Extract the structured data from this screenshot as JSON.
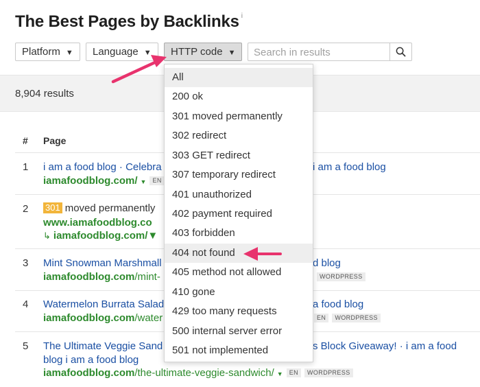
{
  "page": {
    "title": "The Best Pages by Backlinks",
    "title_info": "i"
  },
  "filters": {
    "platform": "Platform",
    "language": "Language",
    "http_code": "HTTP code",
    "search_placeholder": "Search in results"
  },
  "results": {
    "count": "8,904 results"
  },
  "table": {
    "headers": {
      "num": "#",
      "page": "Page"
    },
    "rows": [
      {
        "num": "1",
        "title_left": "i am a food blog · Celebra",
        "title_right": "i am a food blog",
        "url": "iamafoodblog.com/",
        "tag1": "EN"
      },
      {
        "num": "2",
        "status_code": "301",
        "status_text": "moved permanently",
        "url": "www.iamafoodblog.co",
        "redirect_url": "iamafoodblog.com/"
      },
      {
        "num": "3",
        "title_left": "Mint Snowman Marshmall",
        "title_right": "d blog",
        "url_domain": "iamafoodblog.com",
        "url_path": "/mint-",
        "tag2": "WORDPRESS"
      },
      {
        "num": "4",
        "title_left": "Watermelon Burrata Salad",
        "title_right": "a food blog",
        "url_domain": "iamafoodblog.com",
        "url_path": "/water",
        "tag1": "EN",
        "tag2": "WORDPRESS"
      },
      {
        "num": "5",
        "title_left": "The Ultimate Veggie Sand",
        "title_right": "s Block Giveaway! · i am a food",
        "title_line2": "blog i am a food blog",
        "url_domain": "iamafoodblog.com",
        "url_path": "/the-ultimate-veggie-sandwich/",
        "tag1": "EN",
        "tag2": "WORDPRESS"
      }
    ]
  },
  "dropdown": {
    "options": [
      "All",
      "200 ok",
      "301 moved permanently",
      "302 redirect",
      "303 GET redirect",
      "307 temporary redirect",
      "401 unauthorized",
      "402 payment required",
      "403 forbidden",
      "404 not found",
      "405 method not allowed",
      "410 gone",
      "429 too many requests",
      "500 internal server error",
      "501 not implemented"
    ]
  },
  "colors": {
    "link": "#1a4fa3",
    "url": "#2d8a2d",
    "badge": "#f2b53b",
    "annotation_arrow": "#e8336d"
  },
  "icons": [
    "search-icon",
    "caret-down-icon",
    "redirect-arrow-icon",
    "annotation-arrow-icon"
  ]
}
